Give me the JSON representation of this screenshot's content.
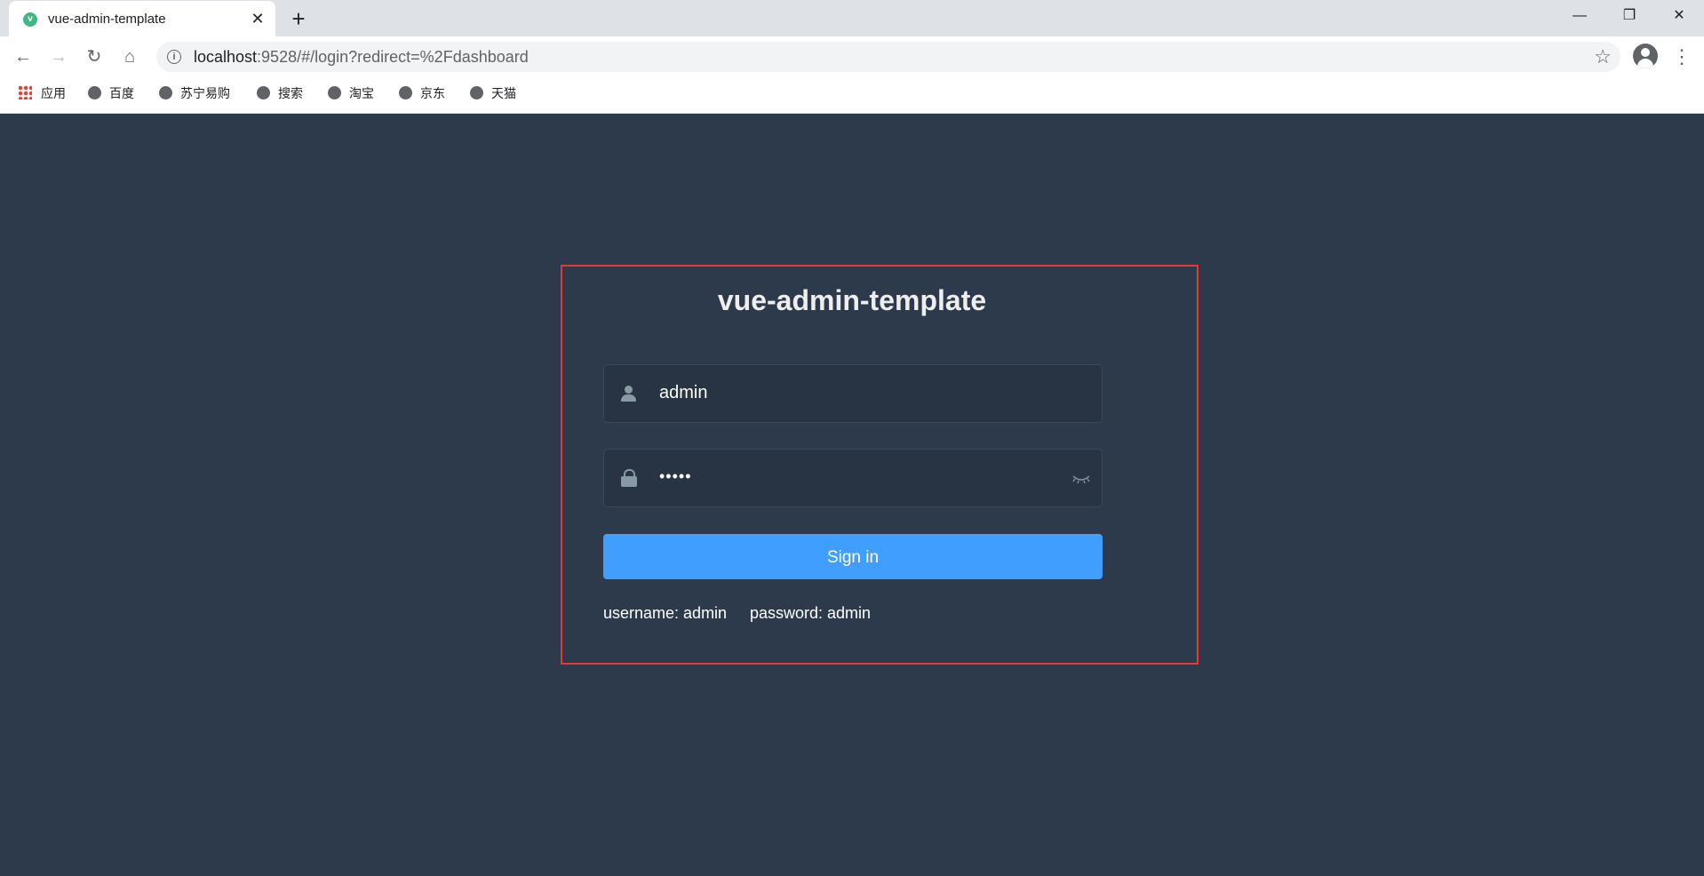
{
  "browser": {
    "tab_title": "vue-admin-template",
    "tab_favicon_letter": "v",
    "url_host": "localhost",
    "url_rest": ":9528/#/login?redirect=%2Fdashboard",
    "bookmarks": [
      "应用",
      "百度",
      "苏宁易购",
      "搜索",
      "淘宝",
      "京东",
      "天猫"
    ]
  },
  "login": {
    "title": "vue-admin-template",
    "username_value": "admin",
    "password_masked": "•••••",
    "signin_label": "Sign in",
    "tip_username": "username: admin",
    "tip_password": "password: admin"
  },
  "colors": {
    "page_bg": "#2d3a4b",
    "input_bg": "#283443",
    "button": "#409eff",
    "highlight_frame": "#e53935"
  }
}
